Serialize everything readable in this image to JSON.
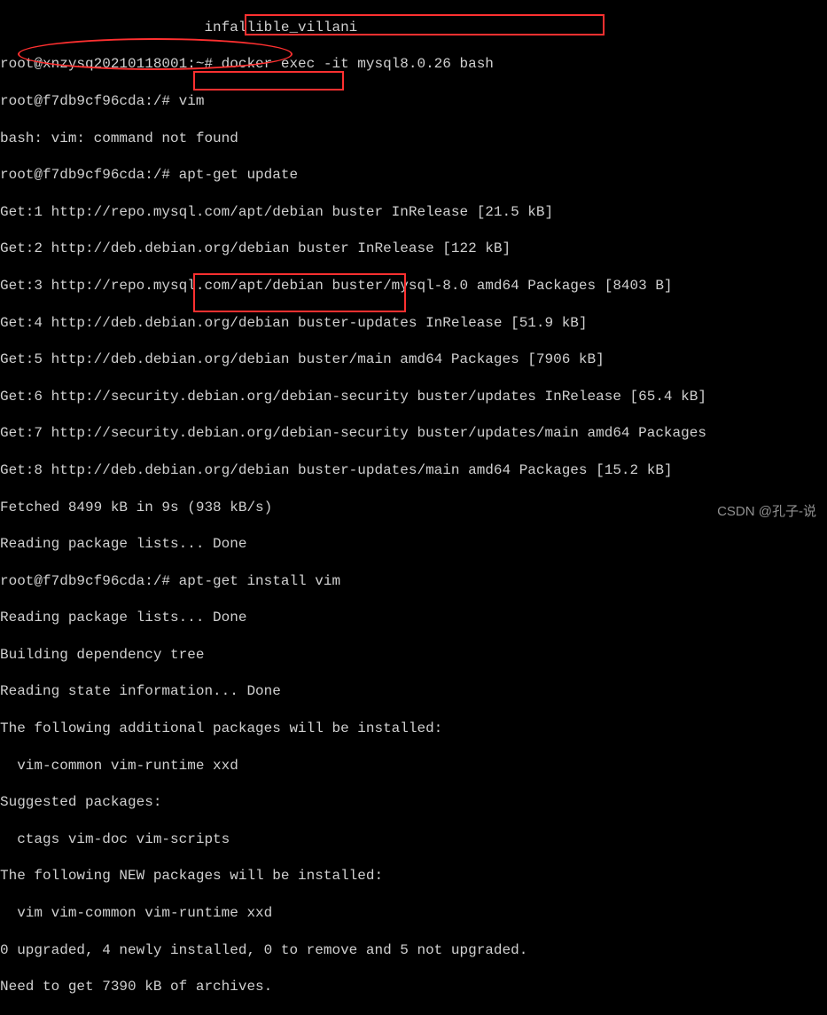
{
  "lines": {
    "l0": "                        infallible_villani",
    "l1": "root@xnzysq20210118001:~# docker exec -it mysql8.0.26 bash",
    "l2": "root@f7db9cf96cda:/# vim",
    "l3": "bash: vim: command not found",
    "l4": "root@f7db9cf96cda:/# apt-get update",
    "l5": "Get:1 http://repo.mysql.com/apt/debian buster InRelease [21.5 kB]",
    "l6": "Get:2 http://deb.debian.org/debian buster InRelease [122 kB]",
    "l7": "Get:3 http://repo.mysql.com/apt/debian buster/mysql-8.0 amd64 Packages [8403 B]",
    "l8": "Get:4 http://deb.debian.org/debian buster-updates InRelease [51.9 kB]",
    "l9": "Get:5 http://deb.debian.org/debian buster/main amd64 Packages [7906 kB]",
    "l10": "Get:6 http://security.debian.org/debian-security buster/updates InRelease [65.4 kB]",
    "l11": "Get:7 http://security.debian.org/debian-security buster/updates/main amd64 Packages",
    "l12": "Get:8 http://deb.debian.org/debian buster-updates/main amd64 Packages [15.2 kB]",
    "l13": "Fetched 8499 kB in 9s (938 kB/s)",
    "l14": "Reading package lists... Done",
    "l15": "root@f7db9cf96cda:/# apt-get install vim",
    "l16": "Reading package lists... Done",
    "l17": "Building dependency tree",
    "l18": "Reading state information... Done",
    "l19": "The following additional packages will be installed:",
    "l20": "  vim-common vim-runtime xxd",
    "l21": "Suggested packages:",
    "l22": "  ctags vim-doc vim-scripts",
    "l23": "The following NEW packages will be installed:",
    "l24": "  vim vim-common vim-runtime xxd",
    "l25": "0 upgraded, 4 newly installed, 0 to remove and 5 not upgraded.",
    "l26": "Need to get 7390 kB of archives."
  },
  "watermark": "CSDN @孔子-说"
}
